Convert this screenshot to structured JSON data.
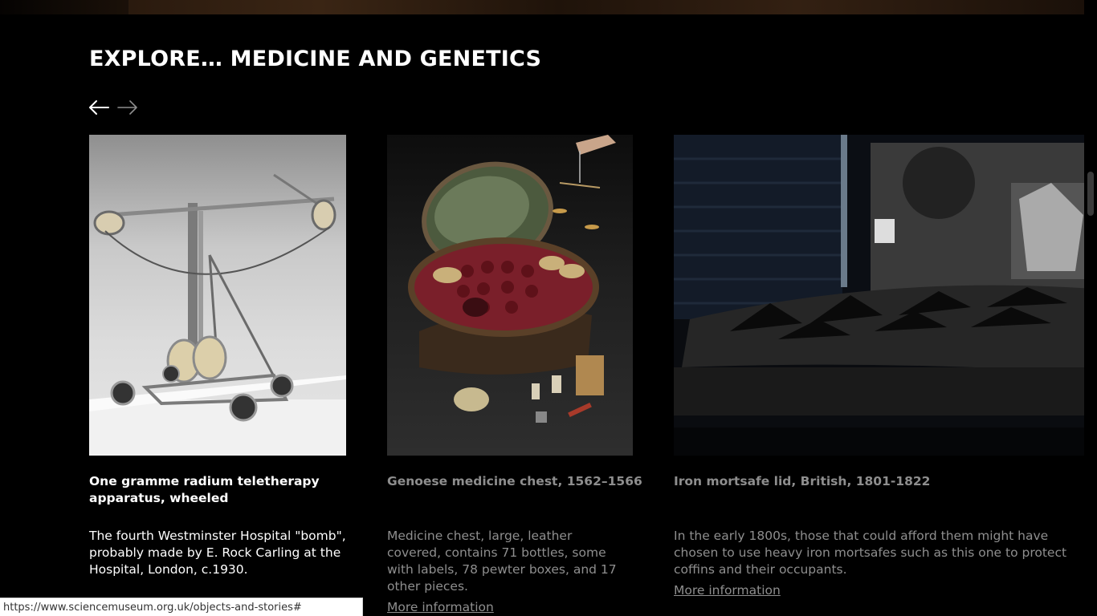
{
  "section": {
    "title": "EXPLORE… MEDICINE AND GENETICS",
    "prev_icon": "arrow-left-icon",
    "next_icon": "arrow-right-icon"
  },
  "cards": [
    {
      "title": "One gramme radium teletherapy apparatus, wheeled",
      "description": "The fourth Westminster Hospital \"bomb\", probably made by E. Rock Carling at the Hospital, London, c.1930.",
      "link": "",
      "active": true
    },
    {
      "title": "Genoese medicine chest, 1562–1566",
      "description": "Medicine chest, large, leather covered, contains 71 bottles, some with labels, 78 pewter boxes, and 17 other pieces.",
      "link": "More information",
      "active": false
    },
    {
      "title": "Iron mortsafe lid, British, 1801-1822",
      "description": "In the early 1800s, those that could afford them might have chosen to use heavy iron mortsafes such as this one to protect coffins and their occupants.",
      "link": "More information",
      "active": false
    }
  ],
  "status_url": "https://www.sciencemuseum.org.uk/objects-and-stories#"
}
